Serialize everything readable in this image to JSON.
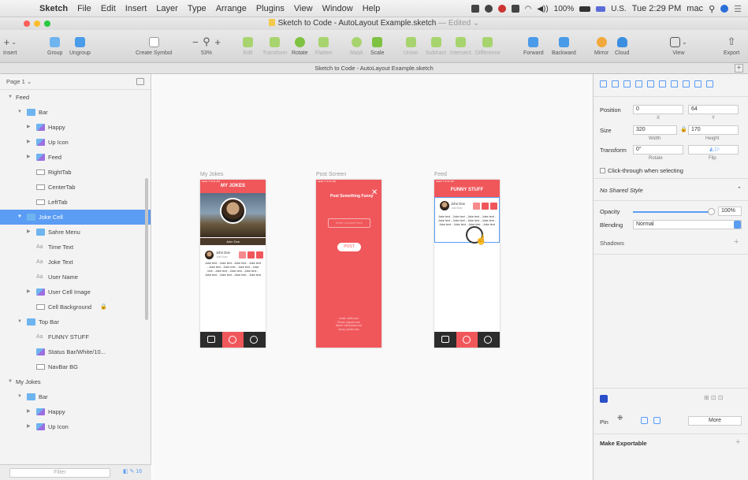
{
  "menubar": {
    "app": "Sketch",
    "items": [
      "File",
      "Edit",
      "Insert",
      "Layer",
      "Type",
      "Arrange",
      "Plugins",
      "View",
      "Window",
      "Help"
    ],
    "battery": "100%",
    "input_source": "U.S.",
    "clock": "Tue 2:29 PM",
    "user": "mac"
  },
  "window": {
    "title": "Sketch to Code - AutoLayout Example.sketch",
    "edited": "— Edited ⌄"
  },
  "toolbar": {
    "insert": "Insert",
    "group": "Group",
    "ungroup": "Ungroup",
    "create_symbol": "Create Symbol",
    "zoom": "53%",
    "edit": "Edit",
    "transform": "Transform",
    "rotate": "Rotate",
    "flatten": "Flatten",
    "mask": "Mask",
    "scale": "Scale",
    "union": "Union",
    "subtract": "Subtract",
    "intersect": "Intersect",
    "difference": "Difference",
    "forward": "Forward",
    "backward": "Backward",
    "mirror": "Mirror",
    "cloud": "Cloud",
    "view": "View",
    "export": "Export"
  },
  "doc_tab": "Sketch to Code - AutoLayout Example.sketch",
  "pages": {
    "current": "Page 1 ⌄"
  },
  "layers": [
    {
      "label": "Feed",
      "indent": 0,
      "arrow": "▼",
      "icon": "none"
    },
    {
      "label": "Bar",
      "indent": 1,
      "arrow": "▼",
      "icon": "folder"
    },
    {
      "label": "Happy",
      "indent": 2,
      "arrow": "▶",
      "icon": "symbol"
    },
    {
      "label": "Up Icon",
      "indent": 2,
      "arrow": "▶",
      "icon": "symbol"
    },
    {
      "label": "Feed",
      "indent": 2,
      "arrow": "▶",
      "icon": "symbol"
    },
    {
      "label": "RightTab",
      "indent": 2,
      "arrow": "",
      "icon": "rect"
    },
    {
      "label": "CenterTab",
      "indent": 2,
      "arrow": "",
      "icon": "rect"
    },
    {
      "label": "LeftTab",
      "indent": 2,
      "arrow": "",
      "icon": "rect"
    },
    {
      "label": "Joke Cell",
      "indent": 1,
      "arrow": "▼",
      "icon": "folder",
      "selected": true
    },
    {
      "label": "Sahre Menu",
      "indent": 2,
      "arrow": "▶",
      "icon": "folder"
    },
    {
      "label": "Time Text",
      "indent": 2,
      "arrow": "",
      "icon": "text"
    },
    {
      "label": "Joke Text",
      "indent": 2,
      "arrow": "",
      "icon": "text"
    },
    {
      "label": "User Name",
      "indent": 2,
      "arrow": "",
      "icon": "text"
    },
    {
      "label": "User Cell Image",
      "indent": 2,
      "arrow": "▶",
      "icon": "symbol"
    },
    {
      "label": "Cell Background",
      "indent": 2,
      "arrow": "",
      "icon": "rect",
      "locked": true
    },
    {
      "label": "Top Bar",
      "indent": 1,
      "arrow": "▼",
      "icon": "folder"
    },
    {
      "label": "FUNNY STUFF",
      "indent": 2,
      "arrow": "",
      "icon": "text"
    },
    {
      "label": "Status Bar/White/10...",
      "indent": 2,
      "arrow": "",
      "icon": "symbol"
    },
    {
      "label": "NavBar BG",
      "indent": 2,
      "arrow": "",
      "icon": "rect"
    },
    {
      "label": "My Jokes",
      "indent": 0,
      "arrow": "▼",
      "icon": "none"
    },
    {
      "label": "Bar",
      "indent": 1,
      "arrow": "▼",
      "icon": "folder"
    },
    {
      "label": "Happy",
      "indent": 2,
      "arrow": "▶",
      "icon": "symbol"
    },
    {
      "label": "Up Icon",
      "indent": 2,
      "arrow": "▶",
      "icon": "symbol"
    }
  ],
  "filter": {
    "placeholder": "Filter",
    "count": "16"
  },
  "artboards": {
    "my_jokes": {
      "label": "My Jokes",
      "title": "MY JOKES",
      "user": "John Doe",
      "name": "John Doe",
      "time": "Just Now",
      "joke": "Joke text - Joke text - Joke text - Joke text - Joke text - Joke text - Joke text - Joke text - Joke text - Joke text - Joke text - Joke text - Joke text - Joke text - Joke text"
    },
    "post": {
      "label": "Post Screen",
      "title": "Post Something Funny",
      "close": "✕",
      "field": "Write Content Here",
      "button": "POST",
      "footer": [
        "email: onelk.com",
        "Phone: pispoet.com",
        "Name: randomuser.me",
        "funny: pastie.com"
      ]
    },
    "feed": {
      "label": "Feed",
      "title": "FUNNY STUFF",
      "name": "John Doe",
      "time": "Just Now",
      "joke": "Joke text - Joke text - Joke text - Joke text - Joke text - Joke text - Joke text - Joke text - Joke text - Joke text - Joke text - Joke text"
    }
  },
  "inspector": {
    "position_label": "Position",
    "x": "0",
    "y": "64",
    "x_label": "X",
    "y_label": "Y",
    "size_label": "Size",
    "width": "320",
    "height": "170",
    "width_label": "Width",
    "height_label": "Height",
    "transform_label": "Transform",
    "rotate": "0°",
    "rotate_label": "Rotate",
    "flip_label": "Flip",
    "clickthrough": "Click-through when selecting",
    "shared_style": "No Shared Style",
    "opacity_label": "Opacity",
    "opacity": "100%",
    "opacity_fraction": 1.0,
    "blending_label": "Blending",
    "blending": "Normal",
    "shadows_label": "Shadows",
    "pin_label": "Pin",
    "more": "More",
    "make_exportable": "Make Exportable"
  },
  "colors": {
    "accent": "#f0575b",
    "selection": "#5b9cf4"
  }
}
